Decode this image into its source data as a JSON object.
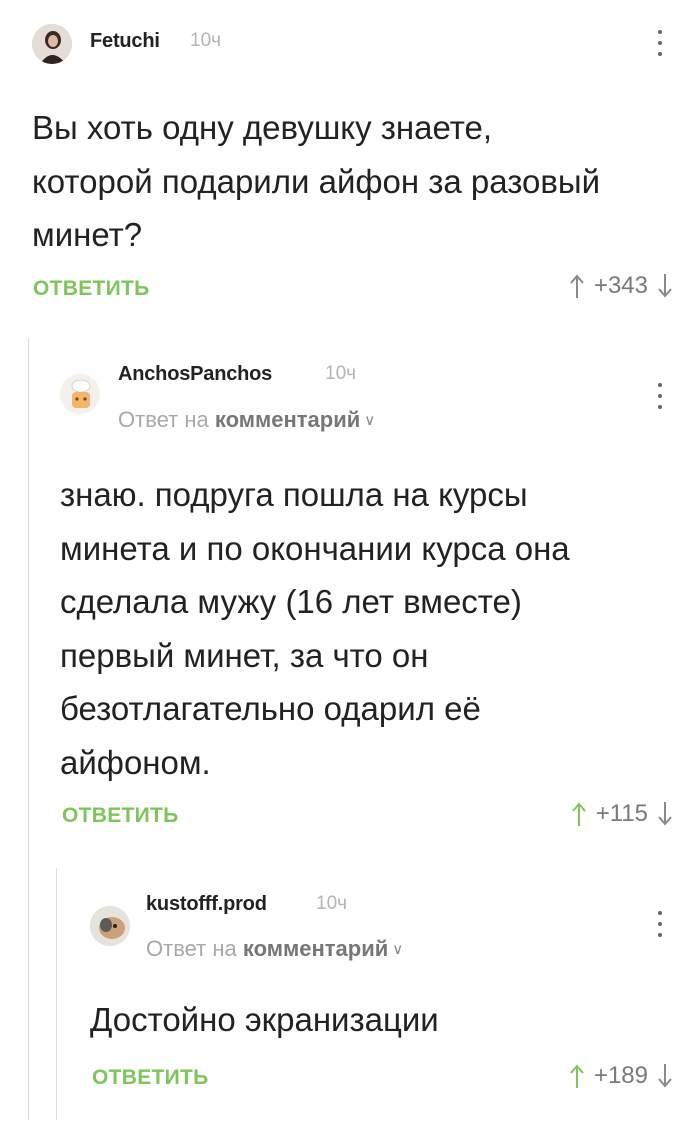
{
  "comments": [
    {
      "author": "Fetuchi",
      "time": "10ч",
      "body": "Вы хоть одну девушку знаете, которой подарили айфон за разовый минет?",
      "reply_label": "ОТВЕТИТЬ",
      "rating": "+343",
      "upvote_active": false
    },
    {
      "author": "AnchosPanchos",
      "time": "10ч",
      "reply_to_prefix": "Ответ на",
      "reply_to_target": "комментарий",
      "body": "знаю. подруга пошла на курсы минета и по окончании курса она сделала мужу (16 лет вместе) первый минет, за что он безотлагательно одарил её айфоном.",
      "reply_label": "ОТВЕТИТЬ",
      "rating": "+115",
      "upvote_active": true
    },
    {
      "author": "kustofff.prod",
      "time": "10ч",
      "reply_to_prefix": "Ответ на",
      "reply_to_target": "комментарий",
      "body": "Достойно экранизации",
      "reply_label": "ОТВЕТИТЬ",
      "rating": "+189",
      "upvote_active": true
    }
  ],
  "colors": {
    "accent_green": "#7fc65a",
    "muted_gray": "#a9a9a9",
    "thread_line": "#dcdcdc"
  }
}
